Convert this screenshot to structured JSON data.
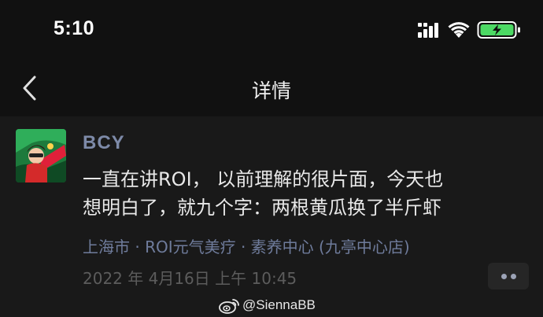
{
  "status_bar": {
    "time": "5:10",
    "icons": [
      "signal-icon",
      "wifi-icon",
      "battery-charging-icon"
    ],
    "battery_color": "#4cd964"
  },
  "nav": {
    "title": "详情",
    "back_icon": "chevron-left-icon"
  },
  "post": {
    "username": "BCY",
    "content_line1": "一直在讲ROI，  以前理解的很片面，今天也",
    "content_line2": "想明白了，就九个字：两根黄瓜换了半斤虾",
    "location": "上海市 · ROI元气美疗 · 素养中心 (九亭中心店)",
    "timestamp": "2022 年 4月16日  上午 10:45",
    "more_icon": "more-dots-icon"
  },
  "watermark": {
    "text": "@SiennaBB",
    "icon": "weibo-icon"
  },
  "colors": {
    "background": "#111111",
    "post_background": "#191919",
    "username": "#7d8aa8",
    "location": "#6f7c9c",
    "timestamp": "#5c5c5c"
  }
}
